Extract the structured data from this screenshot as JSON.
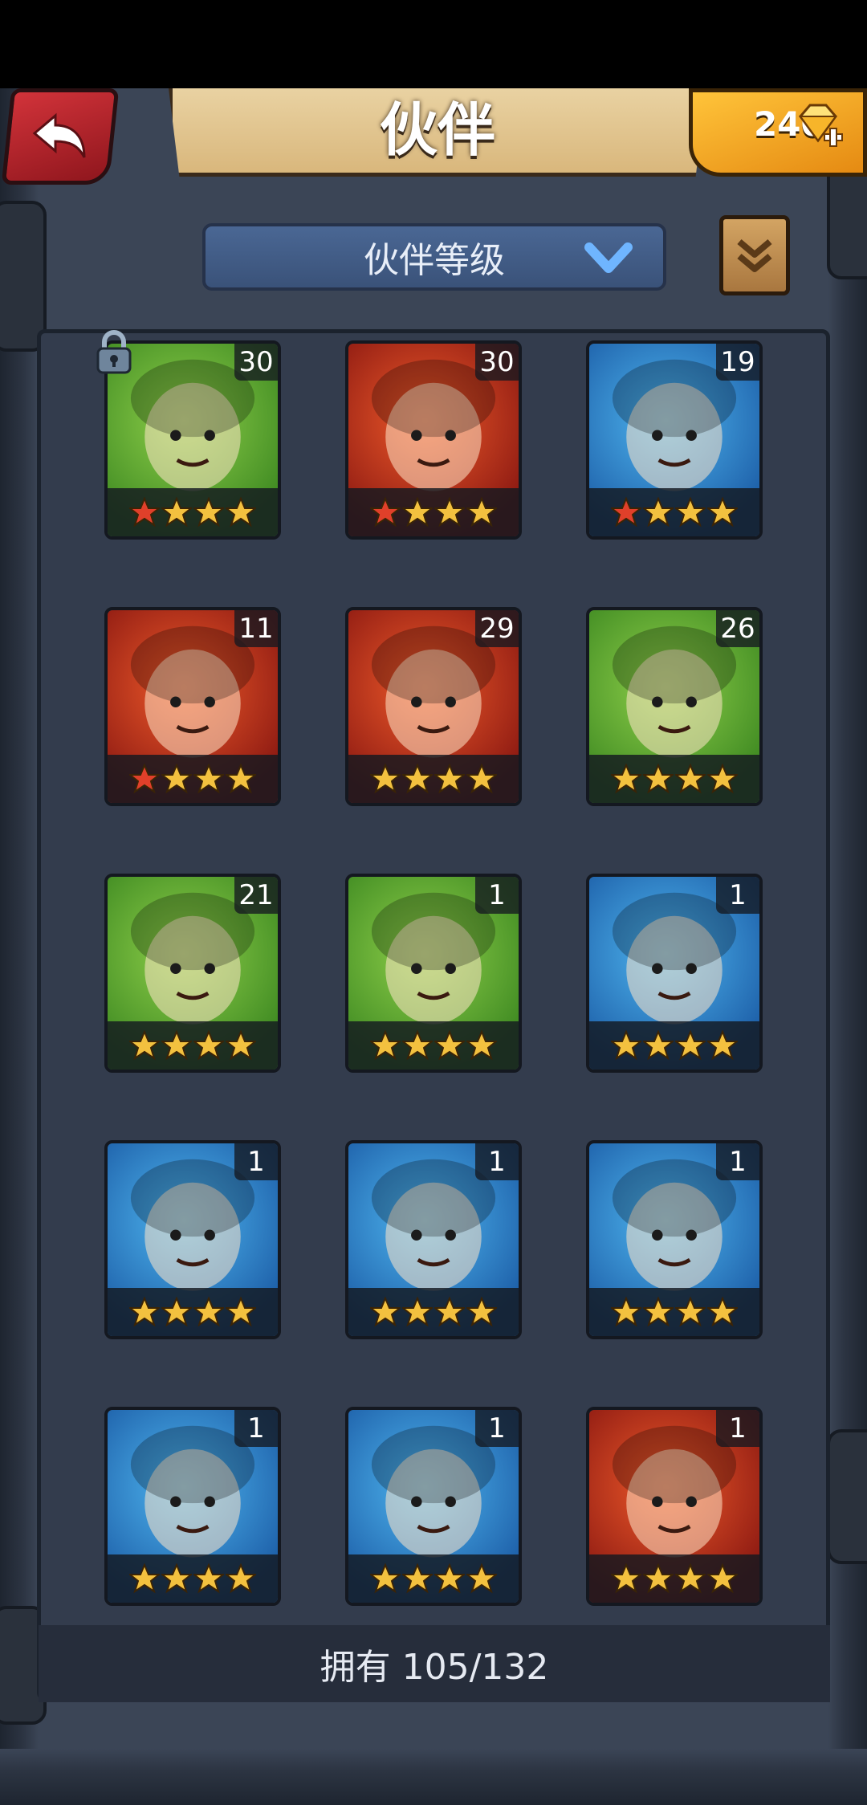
{
  "header": {
    "title": "伙伴",
    "gems": "240"
  },
  "sort": {
    "label": "伙伴等级"
  },
  "colors": {
    "green": "#5fb032",
    "red": "#c8331f",
    "blue": "#2f8fd6",
    "star_gold": "#f3c13f",
    "star_red": "#e0402a"
  },
  "heroes": [
    {
      "level": "30",
      "bg": "green",
      "stars": 4,
      "red_stars": 1,
      "locked": true
    },
    {
      "level": "30",
      "bg": "red",
      "stars": 4,
      "red_stars": 1,
      "locked": false
    },
    {
      "level": "19",
      "bg": "blue",
      "stars": 4,
      "red_stars": 1,
      "locked": false
    },
    {
      "level": "11",
      "bg": "red",
      "stars": 4,
      "red_stars": 1,
      "locked": false
    },
    {
      "level": "29",
      "bg": "red",
      "stars": 4,
      "red_stars": 0,
      "locked": false
    },
    {
      "level": "26",
      "bg": "green",
      "stars": 4,
      "red_stars": 0,
      "locked": false
    },
    {
      "level": "21",
      "bg": "green",
      "stars": 4,
      "red_stars": 0,
      "locked": false
    },
    {
      "level": "1",
      "bg": "green",
      "stars": 4,
      "red_stars": 0,
      "locked": false
    },
    {
      "level": "1",
      "bg": "blue",
      "stars": 4,
      "red_stars": 0,
      "locked": false
    },
    {
      "level": "1",
      "bg": "blue",
      "stars": 4,
      "red_stars": 0,
      "locked": false
    },
    {
      "level": "1",
      "bg": "blue",
      "stars": 4,
      "red_stars": 0,
      "locked": false
    },
    {
      "level": "1",
      "bg": "blue",
      "stars": 4,
      "red_stars": 0,
      "locked": false
    },
    {
      "level": "1",
      "bg": "blue",
      "stars": 4,
      "red_stars": 0,
      "locked": false
    },
    {
      "level": "1",
      "bg": "blue",
      "stars": 4,
      "red_stars": 0,
      "locked": false
    },
    {
      "level": "1",
      "bg": "red",
      "stars": 4,
      "red_stars": 0,
      "locked": false
    }
  ],
  "footer": {
    "owned": "拥有 105/132"
  }
}
